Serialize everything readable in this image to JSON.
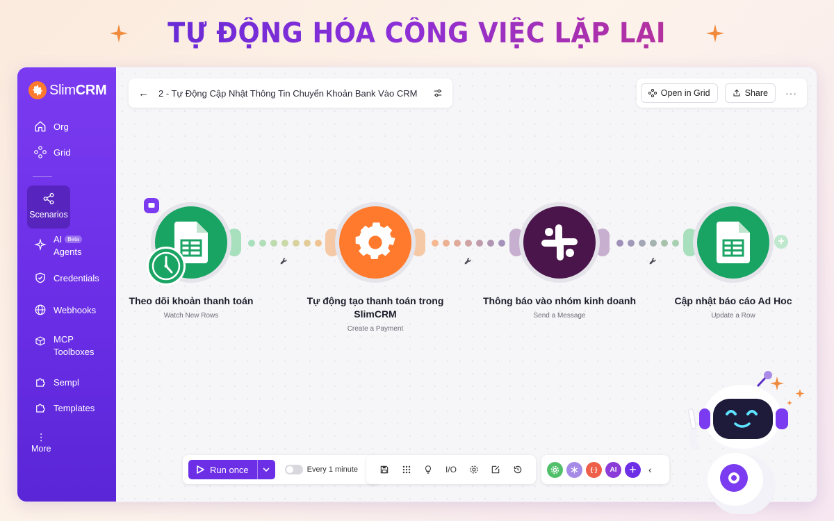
{
  "banner": {
    "title": "TỰ ĐỘNG HÓA CÔNG VIỆC LẶP LẠI"
  },
  "brand": {
    "name_light": "Slim",
    "name_bold": "CRM",
    "accent": "#7b3bf0",
    "orange": "#ff7a2c"
  },
  "sidebar": {
    "items": [
      {
        "label": "Org",
        "icon": "home-icon"
      },
      {
        "label": "Grid",
        "icon": "grid-nodes-icon"
      },
      {
        "label": "Scenarios",
        "icon": "share-icon",
        "active": true
      },
      {
        "label": "AI",
        "label2": "Agents",
        "badge": "Beta",
        "icon": "sparkle-icon"
      },
      {
        "label": "Credentials",
        "icon": "shield-icon"
      },
      {
        "label": "Webhooks",
        "icon": "globe-icon"
      },
      {
        "label": "MCP",
        "label2": "Toolboxes",
        "icon": "toolbox-icon"
      },
      {
        "label": "Sempl",
        "icon": "puzzle-icon"
      },
      {
        "label": "Templates",
        "icon": "puzzle-icon"
      }
    ],
    "more_label": "More"
  },
  "header": {
    "back_icon": "arrow-left-icon",
    "scenario_title": "2 - Tự Động Cập Nhật Thông Tin Chuyển Khoản Bank Vào CRM",
    "settings_icon": "sliders-icon",
    "open_grid_label": "Open in Grid",
    "share_label": "Share",
    "more_icon": "ellipsis-icon"
  },
  "flow": {
    "nodes": [
      {
        "title": "Theo dõi khoản thanh toán",
        "subtitle": "Watch New Rows",
        "icon": "google-sheets-icon",
        "color": "#1aa464"
      },
      {
        "title": "Tự động tạo thanh toán trong SlimCRM",
        "subtitle": "Create a Payment",
        "icon": "gear-icon",
        "color": "#ff7a2c"
      },
      {
        "title": "Thông báo vào nhóm kinh doanh",
        "subtitle": "Send a Message",
        "icon": "slack-icon",
        "color": "#4a154b"
      },
      {
        "title": "Cập nhật báo cáo Ad Hoc",
        "subtitle": "Update a Row",
        "icon": "google-sheets-icon",
        "color": "#1aa464"
      }
    ]
  },
  "toolbar": {
    "run_label": "Run once",
    "schedule_label": "Every 1 minute",
    "io_label": "I/O",
    "ai_label": "AI"
  }
}
